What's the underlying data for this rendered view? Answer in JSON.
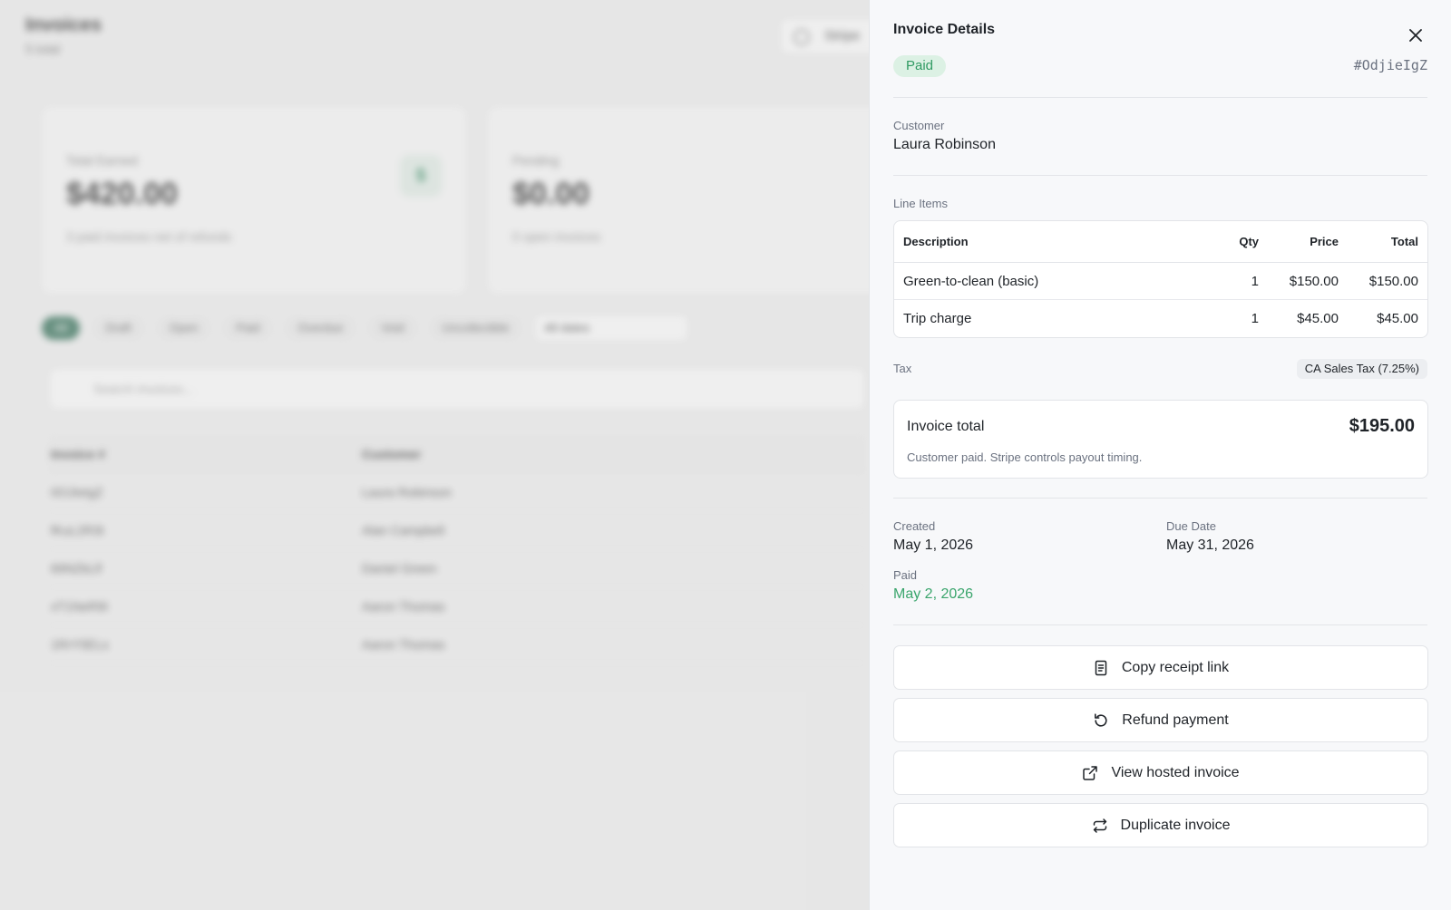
{
  "background": {
    "title": "Invoices",
    "subtitle": "5 total",
    "top_button": "Stripe",
    "cards": [
      {
        "label": "Total Earned",
        "value": "$420.00",
        "note": "3 paid invoices net of refunds",
        "badge": "$"
      },
      {
        "label": "Pending",
        "value": "$0.00",
        "note": "0 open invoices"
      }
    ],
    "filters": [
      "All",
      "Draft",
      "Open",
      "Paid",
      "Overdue",
      "Void",
      "Uncollectible"
    ],
    "date_filter": "All dates",
    "search_placeholder": "Search invoices...",
    "table": {
      "headers": [
        "Invoice #",
        "Customer"
      ],
      "rows": [
        [
          "0OJIeIgZ",
          "Laura Robinson"
        ],
        [
          "fKuL2R3t",
          "Alan Campbell"
        ],
        [
          "69NZkLlf",
          "Daniel Green"
        ],
        [
          "xT1NeR9I",
          "Aaron Thomas"
        ],
        [
          "1RrY5ELs",
          "Aaron Thomas"
        ]
      ]
    }
  },
  "drawer": {
    "title": "Invoice Details",
    "status": "Paid",
    "invoice_id": "#OdjieIgZ",
    "customer_label": "Customer",
    "customer_name": "Laura Robinson",
    "line_items_label": "Line Items",
    "columns": {
      "description": "Description",
      "qty": "Qty",
      "price": "Price",
      "total": "Total"
    },
    "items": [
      {
        "description": "Green-to-clean (basic)",
        "qty": "1",
        "price": "$150.00",
        "total": "$150.00"
      },
      {
        "description": "Trip charge",
        "qty": "1",
        "price": "$45.00",
        "total": "$45.00"
      }
    ],
    "tax_label": "Tax",
    "tax_value": "CA Sales Tax (7.25%)",
    "invoice_total_label": "Invoice total",
    "invoice_total": "$195.00",
    "total_note": "Customer paid. Stripe controls payout timing.",
    "created_label": "Created",
    "created": "May 1, 2026",
    "due_label": "Due Date",
    "due": "May 31, 2026",
    "paid_label": "Paid",
    "paid": "May 2, 2026",
    "actions": {
      "copy_receipt": "Copy receipt link",
      "refund": "Refund payment",
      "view_hosted": "View hosted invoice",
      "duplicate": "Duplicate invoice"
    }
  },
  "colors": {
    "paid_green": "#2f9a62",
    "paid_bg": "#dcf1e4",
    "accent_dark_green": "#2f6e55"
  },
  "icons": {
    "close": "close-icon",
    "copy_receipt": "receipt-icon",
    "refund": "refund-icon",
    "view_hosted": "external-link-icon",
    "duplicate": "repeat-icon"
  }
}
